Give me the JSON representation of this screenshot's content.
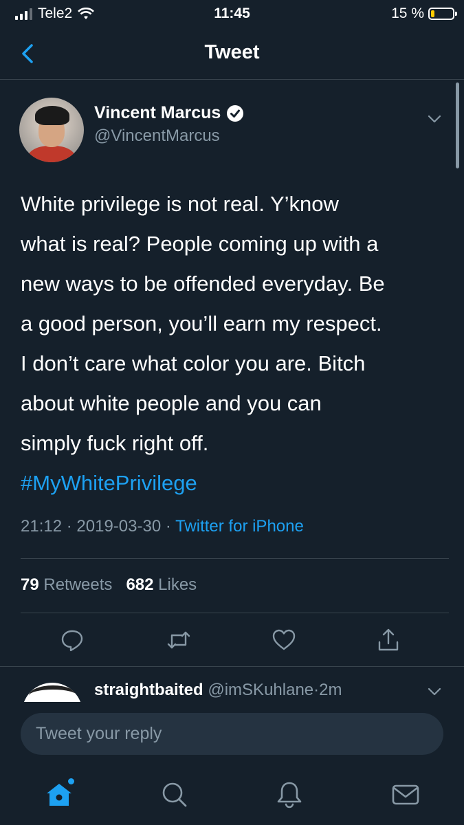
{
  "status_bar": {
    "carrier": "Tele2",
    "time": "11:45",
    "battery_text": "15 %",
    "battery_level": 0.15,
    "signal_bars": 3
  },
  "nav": {
    "title": "Tweet",
    "back_icon": "chevron-left-icon"
  },
  "tweet": {
    "author_name": "Vincent Marcus",
    "author_handle": "@VincentMarcus",
    "lines": [
      "White privilege is not real. Y’know",
      "what is real? People coming up with a",
      "new ways to be offended everyday. Be",
      "a good person, you’ll earn my respect.",
      "I don’t care what color you are. Bitch",
      "about white people and you can",
      "simply fuck right off."
    ],
    "hashtag": "#MyWhitePrivilege",
    "time": "21:12",
    "date": "2019-03-30",
    "separator": "·",
    "source": "Twitter for iPhone",
    "retweets_count": "79",
    "retweets_label": "Retweets",
    "likes_count": "682",
    "likes_label": "Likes"
  },
  "reply": {
    "username": "straightbaited",
    "handle": "@imSKuhlane",
    "age": "2m",
    "separator": "·"
  },
  "compose": {
    "placeholder": "Tweet your reply"
  },
  "colors": {
    "background": "#15202b",
    "accent": "#1da1f2",
    "muted": "#8899a6",
    "divider": "#38444d",
    "battery": "#ffcc00"
  },
  "icons": {
    "actions": [
      "reply-icon",
      "retweet-icon",
      "like-icon",
      "share-icon"
    ],
    "tabs": [
      "home-icon",
      "search-icon",
      "notifications-icon",
      "messages-icon"
    ]
  }
}
